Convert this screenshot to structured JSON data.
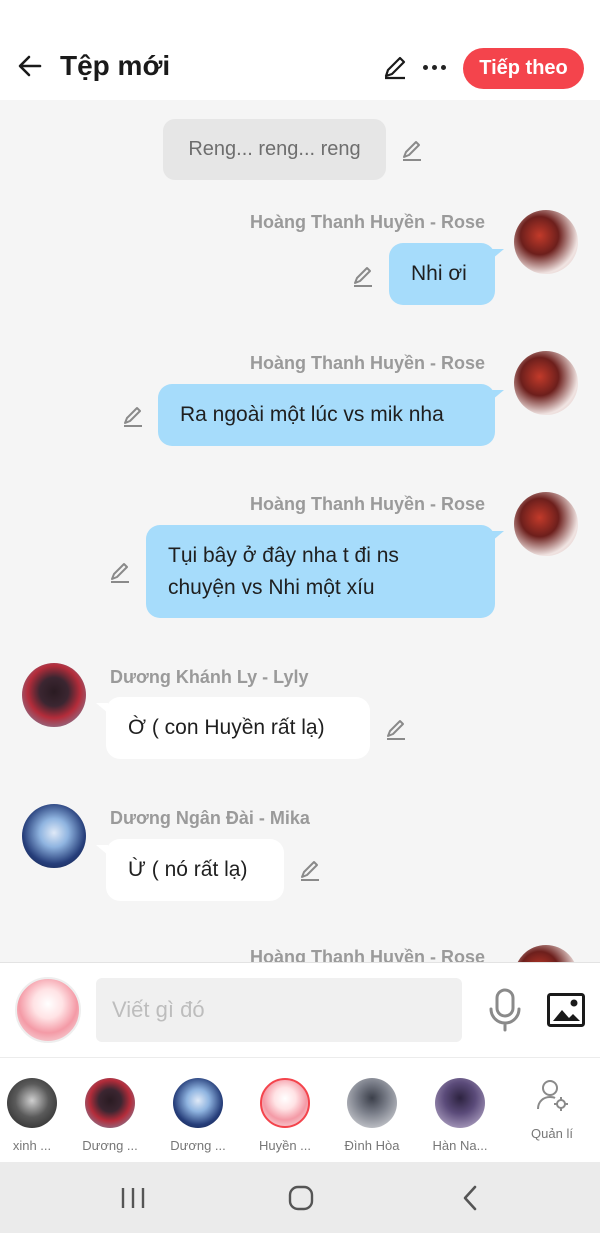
{
  "header": {
    "title": "Tệp mới",
    "next_label": "Tiếp theo",
    "accent": "#f4444c"
  },
  "chat": {
    "narration": "Reng... reng... reng",
    "messages": [
      {
        "sender": "Hoàng Thanh Huyền - Rose",
        "text": "Nhi ơi",
        "side": "right"
      },
      {
        "sender": "Hoàng Thanh Huyền - Rose",
        "text": "Ra ngoài một lúc vs mik nha",
        "side": "right"
      },
      {
        "sender": "Hoàng Thanh Huyền - Rose",
        "text_line1": "Tụi bây ở đây nha t đi ns",
        "text_line2": "chuyện vs Nhi một xíu",
        "side": "right"
      },
      {
        "sender": "Dương Khánh Ly - Lyly",
        "text": "Ờ ( con Huyền rất lạ)",
        "side": "left"
      },
      {
        "sender": "Dương Ngân Đài - Mika",
        "text": "Ừ ( nó rất lạ)",
        "side": "left"
      },
      {
        "sender": "Hoàng Thanh Huyền - Rose",
        "side": "right"
      }
    ],
    "bubble_color": "#a6dcfb"
  },
  "composer": {
    "placeholder": "Viết gì đó"
  },
  "characters": [
    {
      "label": "xinh ..."
    },
    {
      "label": "Dương ..."
    },
    {
      "label": "Dương ..."
    },
    {
      "label": "Huyền ..."
    },
    {
      "label": "Đình Hòa"
    },
    {
      "label": "Hàn Na..."
    }
  ],
  "manage_label": "Quản lí"
}
